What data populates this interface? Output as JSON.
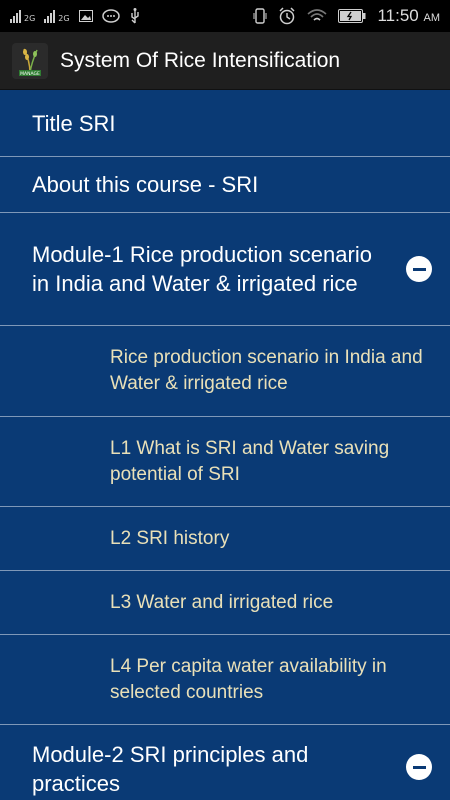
{
  "status_bar": {
    "network_label_1": "2G",
    "network_label_2": "2G",
    "time": "11:50",
    "ampm": "AM"
  },
  "app_bar": {
    "title": "System Of Rice Intensification",
    "logo_caption": "MANAGE"
  },
  "menu": {
    "title_sri": "Title SRI",
    "about": "About this course - SRI",
    "module1": {
      "label": "Module-1 Rice production scenario in India and Water & irrigated rice",
      "lessons": [
        "Rice production scenario in India and Water & irrigated rice",
        "L1 What is SRI and Water saving potential of SRI",
        "L2 SRI history",
        "L3 Water and irrigated rice",
        "L4 Per capita water availability in selected countries"
      ]
    },
    "module2": {
      "label": "Module-2 SRI principles and practices"
    }
  },
  "colors": {
    "background": "#0a3a75",
    "divider": "#7f98b8",
    "lesson_text": "#e9e0b8"
  }
}
